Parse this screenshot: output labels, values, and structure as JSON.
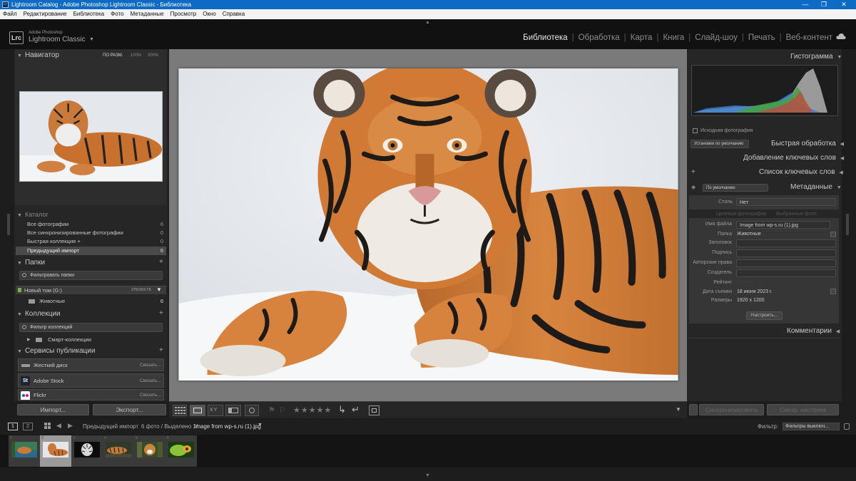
{
  "window": {
    "title": "Lightroom Catalog - Adobe Photoshop Lightroom Classic - Библиотека",
    "icon_text": "Lr"
  },
  "menu": [
    "Файл",
    "Редактирование",
    "Библиотека",
    "Фото",
    "Метаданные",
    "Просмотр",
    "Окно",
    "Справка"
  ],
  "brand": {
    "badge": "Lrc",
    "line1": "Adobe Photoshop",
    "line2": "Lightroom Classic"
  },
  "modules": [
    "Библиотека",
    "Обработка",
    "Карта",
    "Книга",
    "Слайд-шоу",
    "Печать",
    "Веб-контент"
  ],
  "active_module": "Библиотека",
  "left": {
    "navigator": {
      "title": "Навигатор",
      "zooms": [
        "ПО РАЗМ.",
        "100%",
        "300%"
      ]
    },
    "catalog": {
      "title": "Каталог",
      "items": [
        {
          "label": "Все фотографии",
          "count": "6"
        },
        {
          "label": "Все синхронизированные фотографии",
          "count": "0"
        },
        {
          "label": "Быстрая коллекция  +",
          "count": "0"
        },
        {
          "label": "Предыдущий импорт",
          "count": "6"
        }
      ]
    },
    "folders": {
      "title": "Папки",
      "filter": "Фильтровать папки",
      "volume": "Новый том (G:)",
      "volume_size": "275/293 ГБ",
      "sub": "Животные",
      "sub_count": "6"
    },
    "collections": {
      "title": "Коллекции",
      "filter": "Фильтр коллекций",
      "smart": "Смарт-коллекции"
    },
    "publish": {
      "title": "Сервисы публикации",
      "services": [
        {
          "name": "Жесткий диск",
          "action": "Связать..."
        },
        {
          "name": "Adobe Stock",
          "action": "Связать..."
        },
        {
          "name": "Flickr",
          "action": "Связать..."
        }
      ]
    },
    "import_label": "Импорт...",
    "export_label": "Экспорт..."
  },
  "right": {
    "histogram": {
      "title": "Гистограмма",
      "original": "Исходная фотография"
    },
    "quick_develop": {
      "title": "Быстрая обработка",
      "preset": "Установки по умолчанию"
    },
    "add_keywords": {
      "title": "Добавление ключевых слов"
    },
    "keyword_list": {
      "title": "Список ключевых слов"
    },
    "metadata": {
      "title": "Метаданные",
      "preset": "По умолчанию",
      "style_label": "Стиль",
      "style_value": "Нет",
      "tab1": "Целевая фотография",
      "tab2": "Выбранные фото",
      "fields": [
        {
          "label": "Имя файла",
          "value": "Image from wp-s.ru (1).jpg"
        },
        {
          "label": "Папка",
          "value": "Животные"
        },
        {
          "label": "Заголовок",
          "value": ""
        },
        {
          "label": "Подпись",
          "value": ""
        },
        {
          "label": "Авторские права",
          "value": ""
        },
        {
          "label": "Создатель",
          "value": ""
        },
        {
          "label": "Рейтинг",
          "value": ""
        },
        {
          "label": "Дата съемки",
          "value": "18 июня 2023 г."
        },
        {
          "label": "Размеры",
          "value": "1920 x 1200"
        }
      ],
      "customize": "Настроить..."
    },
    "comments": {
      "title": "Комментарии"
    },
    "sync_label": "Синхронизировать",
    "sync_settings_label": "Синхр. настроек"
  },
  "filmstrip": {
    "source": "Предыдущий импорт",
    "info": "6 фото / Выделено 1/",
    "filename": "Image from wp-s.ru (1).jpg",
    "filter_label": "Фильтр:",
    "filter_value": "Фильтры выключ...",
    "pages": [
      "1",
      "2"
    ],
    "selected_index": 1
  },
  "colors": {
    "accent_title": "#0d6bc5",
    "panel": "#2b2b2b",
    "background": "#1d1d1d"
  }
}
